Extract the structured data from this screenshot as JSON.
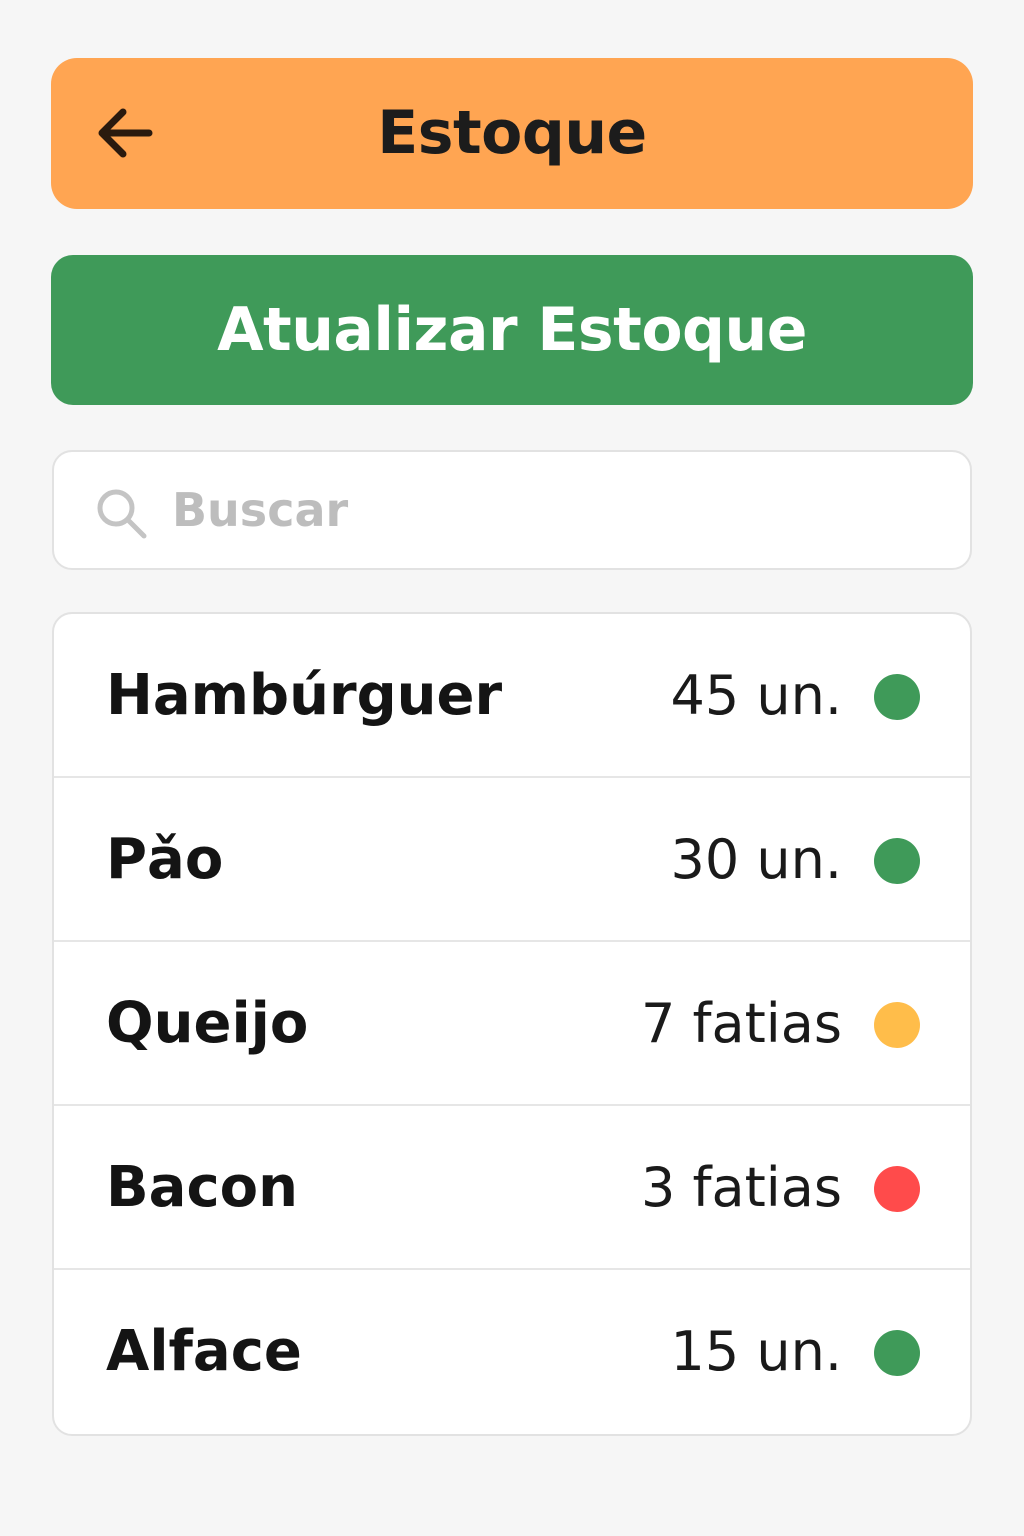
{
  "header": {
    "title": "Estoque",
    "back_icon": "arrow-left-icon",
    "background_color": "#ffa552"
  },
  "actions": {
    "update_label": "Atualizar Estoque",
    "update_color": "#3f9a59"
  },
  "search": {
    "placeholder": "Buscar",
    "value": "",
    "icon": "search-icon"
  },
  "status_colors": {
    "ok": "#3f9a59",
    "low": "#ffbd4a",
    "critical": "#ff4b4b"
  },
  "items": [
    {
      "name": "Hambúrguer",
      "quantity": "45 un.",
      "status": "ok"
    },
    {
      "name": "Pǎo",
      "quantity": "30 un.",
      "status": "ok"
    },
    {
      "name": "Queijo",
      "quantity": "7 fatias",
      "status": "low"
    },
    {
      "name": "Bacon",
      "quantity": "3 fatias",
      "status": "critical"
    },
    {
      "name": "Alface",
      "quantity": "15 un.",
      "status": "ok"
    }
  ]
}
